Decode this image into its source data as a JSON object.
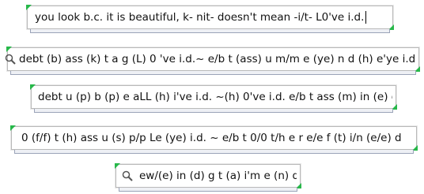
{
  "fields": [
    {
      "value": "you look b.c. it is beautiful, k- nit-  doesn't mean -i/t-  L0've i.d.",
      "has_cursor": true
    },
    {
      "value": "debt (b) ass (k) t a g (L) 0 've i.d.~ e/b t (ass) u m/m e (ye) n d (h) e'ye i.d."
    },
    {
      "value": "debt u (p) b (p) e aLL (h) i've i.d. ~(h) 0've i.d. e/b t ass (m) in (e) d"
    },
    {
      "value": "0 (f/f) t (h) ass u (s) p/p Le (ye) i.d. ~ e/b t 0/0 t/h e r e/e f (t) i/n (e/e) d"
    },
    {
      "value": "ew/(e) in (d) g t (a) i'm e (n) d"
    }
  ],
  "icons": {
    "search": "magnifier-icon",
    "corner_marker": "green-corner-marker"
  },
  "colors": {
    "corner_marker": "#27b84a",
    "border": "#b9b9b9"
  }
}
